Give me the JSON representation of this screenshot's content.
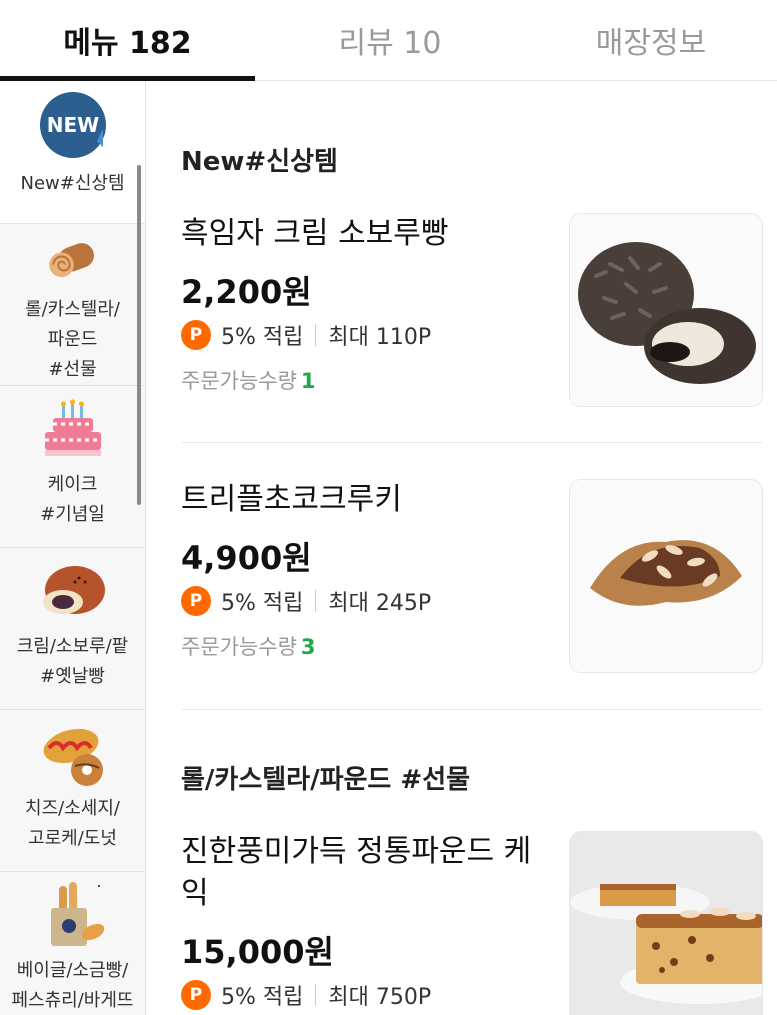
{
  "tabs": [
    {
      "label": "메뉴 182",
      "active": true
    },
    {
      "label": "리뷰 10",
      "active": false
    },
    {
      "label": "매장정보",
      "active": false
    }
  ],
  "sidebar": {
    "items": [
      {
        "label": "New#신상템",
        "icon": "new-badge-icon"
      },
      {
        "label": "롤/카스텔라/\n파운드\n#선물",
        "icon": "roll-cake-icon"
      },
      {
        "label": "케이크\n#기념일",
        "icon": "birthday-cake-icon"
      },
      {
        "label": "크림/소보루/팥\n#옛날빵",
        "icon": "red-bean-bun-icon"
      },
      {
        "label": "치즈/소세지/\n고로케/도넛",
        "icon": "sausage-bread-icon"
      },
      {
        "label": "베이글/소금빵/\n페스츄리/바게뜨",
        "icon": "bread-bag-icon"
      }
    ],
    "new_badge_text": "NEW"
  },
  "sections": [
    {
      "title": "New#신상템",
      "items": [
        {
          "name": "흑임자 크림 소보루빵",
          "price": "2,200원",
          "point_badge": "P",
          "point_rate": "5% 적립",
          "point_max": "최대 110P",
          "stock_label": "주문가능수량",
          "stock_qty": "1"
        },
        {
          "name": "트리플초코크루키",
          "price": "4,900원",
          "point_badge": "P",
          "point_rate": "5% 적립",
          "point_max": "최대 245P",
          "stock_label": "주문가능수량",
          "stock_qty": "3"
        }
      ]
    },
    {
      "title": "롤/카스텔라/파운드 #선물",
      "items": [
        {
          "name": "진한풍미가득 정통파운드 케익",
          "price": "15,000원",
          "point_badge": "P",
          "point_rate": "5% 적립",
          "point_max": "최대 750P"
        }
      ]
    }
  ],
  "colors": {
    "point_badge": "#ff6a00",
    "stock_qty": "#20a84a",
    "active_tab": "#111111"
  }
}
